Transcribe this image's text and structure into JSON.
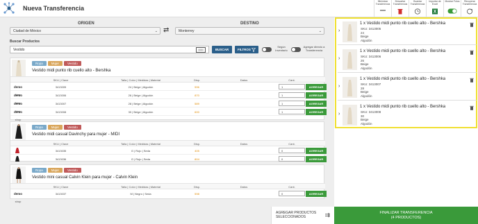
{
  "header": {
    "title": "Nueva Transferencia",
    "toolbar": [
      {
        "label": "Minimizar Transferencia",
        "icon": "minimize-icon"
      },
      {
        "label": "Descartar Transferencia",
        "icon": "trash-icon"
      },
      {
        "label": "Guardar Transferencia",
        "icon": "clock-icon"
      },
      {
        "label": "Importar de Excel",
        "icon": "excel-icon"
      },
      {
        "label": "Mostrar Fotos",
        "icon": "toggle-on-icon"
      },
      {
        "label": "Recuperar Transferencia",
        "icon": "refresh-icon"
      }
    ]
  },
  "route": {
    "origin_label": "ORIGEN",
    "origin_value": "Ciudad de México",
    "destination_label": "DESTINO",
    "destination_value": "Monterrey"
  },
  "search": {
    "label": "Buscar Productos",
    "value": "Vestido",
    "button": "BUSCAR",
    "filters": "FILTROS",
    "toggle_inventory": "Según Inventario",
    "toggle_direct": "Agregar directo a Transferencia"
  },
  "table_headers": [
    "SKU | Clave",
    "Talla | Color | Medidas | Material",
    "Disp.",
    "Datos",
    "Cant."
  ],
  "add_label": "AGREGAR",
  "demo_shop": {
    "top": "demo",
    "bottom": "shop"
  },
  "products": [
    {
      "tags": [
        "Ropa",
        "Mujer",
        "Vestido"
      ],
      "name": "Vestido midi punto rib cuello alto - Bershka",
      "rows": [
        {
          "sku": "3413005",
          "variant": "24 | Beige | Algodón",
          "stock": "596",
          "qty": "1"
        },
        {
          "sku": "3413006",
          "variant": "26 | Beige | Algodón",
          "stock": "870",
          "qty": "1"
        },
        {
          "sku": "3413007",
          "variant": "28 | Beige | Algodón",
          "stock": "589",
          "qty": "1"
        },
        {
          "sku": "3413008",
          "variant": "30 | Beige | Algodón",
          "stock": "600",
          "qty": "1"
        }
      ]
    },
    {
      "tags": [
        "Ropa",
        "Mujer",
        "Vestido"
      ],
      "name": "Vestido midi casual Davinchy para mujer - MIDI",
      "rows": [
        {
          "sku": "3413035",
          "variant": "G | Rojo | Seda",
          "stock": "405",
          "qty": "0"
        },
        {
          "sku": "3413036",
          "variant": "G | Rojo | Seda",
          "stock": "804",
          "qty": "0"
        }
      ]
    },
    {
      "tags": [
        "Ropa",
        "Mujer",
        "Vestido"
      ],
      "name": "Vestido mini casual Calvin Klein para mujer - Calvin Klein",
      "rows": [
        {
          "sku": "3413037",
          "variant": "M | Negro | Seda",
          "stock": "598",
          "qty": "0"
        }
      ]
    }
  ],
  "cart": [
    {
      "title": "1 x Vestido midi punto rib cuello alto - Bershka",
      "sku": "SKU: 3413005",
      "size": "24",
      "color": "Beige",
      "material": "Algodón"
    },
    {
      "title": "1 x Vestido midi punto rib cuello alto - Bershka",
      "sku": "SKU: 3413006",
      "size": "26",
      "color": "Beige",
      "material": "Algodón"
    },
    {
      "title": "1 x Vestido midi punto rib cuello alto - Bershka",
      "sku": "SKU: 3413007",
      "size": "28",
      "color": "Beige",
      "material": "Algodón"
    },
    {
      "title": "1 x Vestido midi punto rib cuello alto - Bershka",
      "sku": "SKU: 3413008",
      "size": "30",
      "color": "Beige",
      "material": "Algodón"
    }
  ],
  "footer": {
    "add_selected_line1": "AGREGAR PRODUCTOS",
    "add_selected_line2": "SELECCIONADOS",
    "finalize_line1": "FINALIZAR TRANSFERENCIA",
    "finalize_line2": "(4 PRODUCTOS)"
  },
  "colors": {
    "tag_ropa": "#7aa9c9",
    "tag_mujer": "#d9a65c",
    "tag_vestido": "#c05a5a",
    "primary": "#2b5f8a",
    "success": "#3a9a3a",
    "highlight": "#f0e030"
  }
}
